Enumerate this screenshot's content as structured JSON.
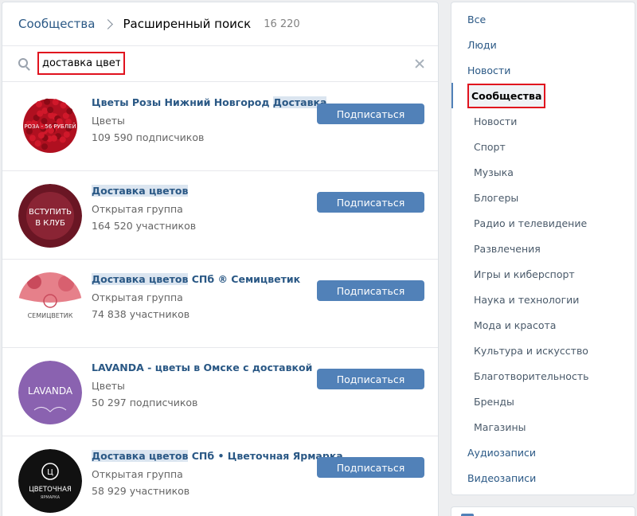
{
  "header": {
    "breadcrumb": "Сообщества",
    "title": "Расширенный поиск",
    "count": "16 220"
  },
  "search": {
    "value": "доставка цветов"
  },
  "subscribe_label": "Подписаться",
  "results": [
    {
      "name_parts": [
        {
          "t": "Цветы Розы Нижний Новгород ",
          "hl": false
        },
        {
          "t": "Доставка",
          "hl": true
        }
      ],
      "category": "Цветы",
      "members": "109 590 подписчиков",
      "avatar_text": "РОЗА - 56 РУБЛЕЙ"
    },
    {
      "name_parts": [
        {
          "t": "Доставка цветов",
          "hl": true
        }
      ],
      "category": "Открытая группа",
      "members": "164 520 участников",
      "avatar_text": [
        "ВСТУПИТЬ",
        "В КЛУБ"
      ]
    },
    {
      "name_parts": [
        {
          "t": "Доставка цветов",
          "hl": true
        },
        {
          "t": " СПб ® Семицветик",
          "hl": false
        }
      ],
      "category": "Открытая группа",
      "members": "74 838 участников",
      "avatar_text": "СЕМИЦВЕТИК"
    },
    {
      "name_parts": [
        {
          "t": "LAVANDA - цветы в Омске с доставкой",
          "hl": false
        }
      ],
      "category": "Цветы",
      "members": "50 297 подписчиков",
      "avatar_text": "LAVANDA"
    },
    {
      "name_parts": [
        {
          "t": "Доставка цветов",
          "hl": true
        },
        {
          "t": " СПб • Цветочная Ярмарка",
          "hl": false
        }
      ],
      "category": "Открытая группа",
      "members": "58 929 участников",
      "avatar_text": [
        "ЦВЕТОЧНАЯ",
        "ЯРМАРКА"
      ]
    }
  ],
  "menu": [
    {
      "label": "Все",
      "level": "top"
    },
    {
      "label": "Люди",
      "level": "top"
    },
    {
      "label": "Новости",
      "level": "top"
    },
    {
      "label": "Сообщества",
      "level": "top",
      "active": true
    },
    {
      "label": "Новости",
      "level": "sub"
    },
    {
      "label": "Спорт",
      "level": "sub"
    },
    {
      "label": "Музыка",
      "level": "sub"
    },
    {
      "label": "Блогеры",
      "level": "sub"
    },
    {
      "label": "Радио и телевидение",
      "level": "sub"
    },
    {
      "label": "Развлечения",
      "level": "sub"
    },
    {
      "label": "Игры и киберспорт",
      "level": "sub"
    },
    {
      "label": "Наука и технологии",
      "level": "sub"
    },
    {
      "label": "Мода и красота",
      "level": "sub"
    },
    {
      "label": "Культура и искусство",
      "level": "sub"
    },
    {
      "label": "Благотворительность",
      "level": "sub"
    },
    {
      "label": "Бренды",
      "level": "sub"
    },
    {
      "label": "Магазины",
      "level": "sub"
    },
    {
      "label": "Аудиозаписи",
      "level": "top"
    },
    {
      "label": "Видеозаписи",
      "level": "top"
    }
  ],
  "colors": {
    "accent": "#5181b8",
    "link": "#2a5885",
    "highlight_box": "#e0121e"
  },
  "icons": [
    "search-icon",
    "chevron-right-icon",
    "close-icon"
  ]
}
